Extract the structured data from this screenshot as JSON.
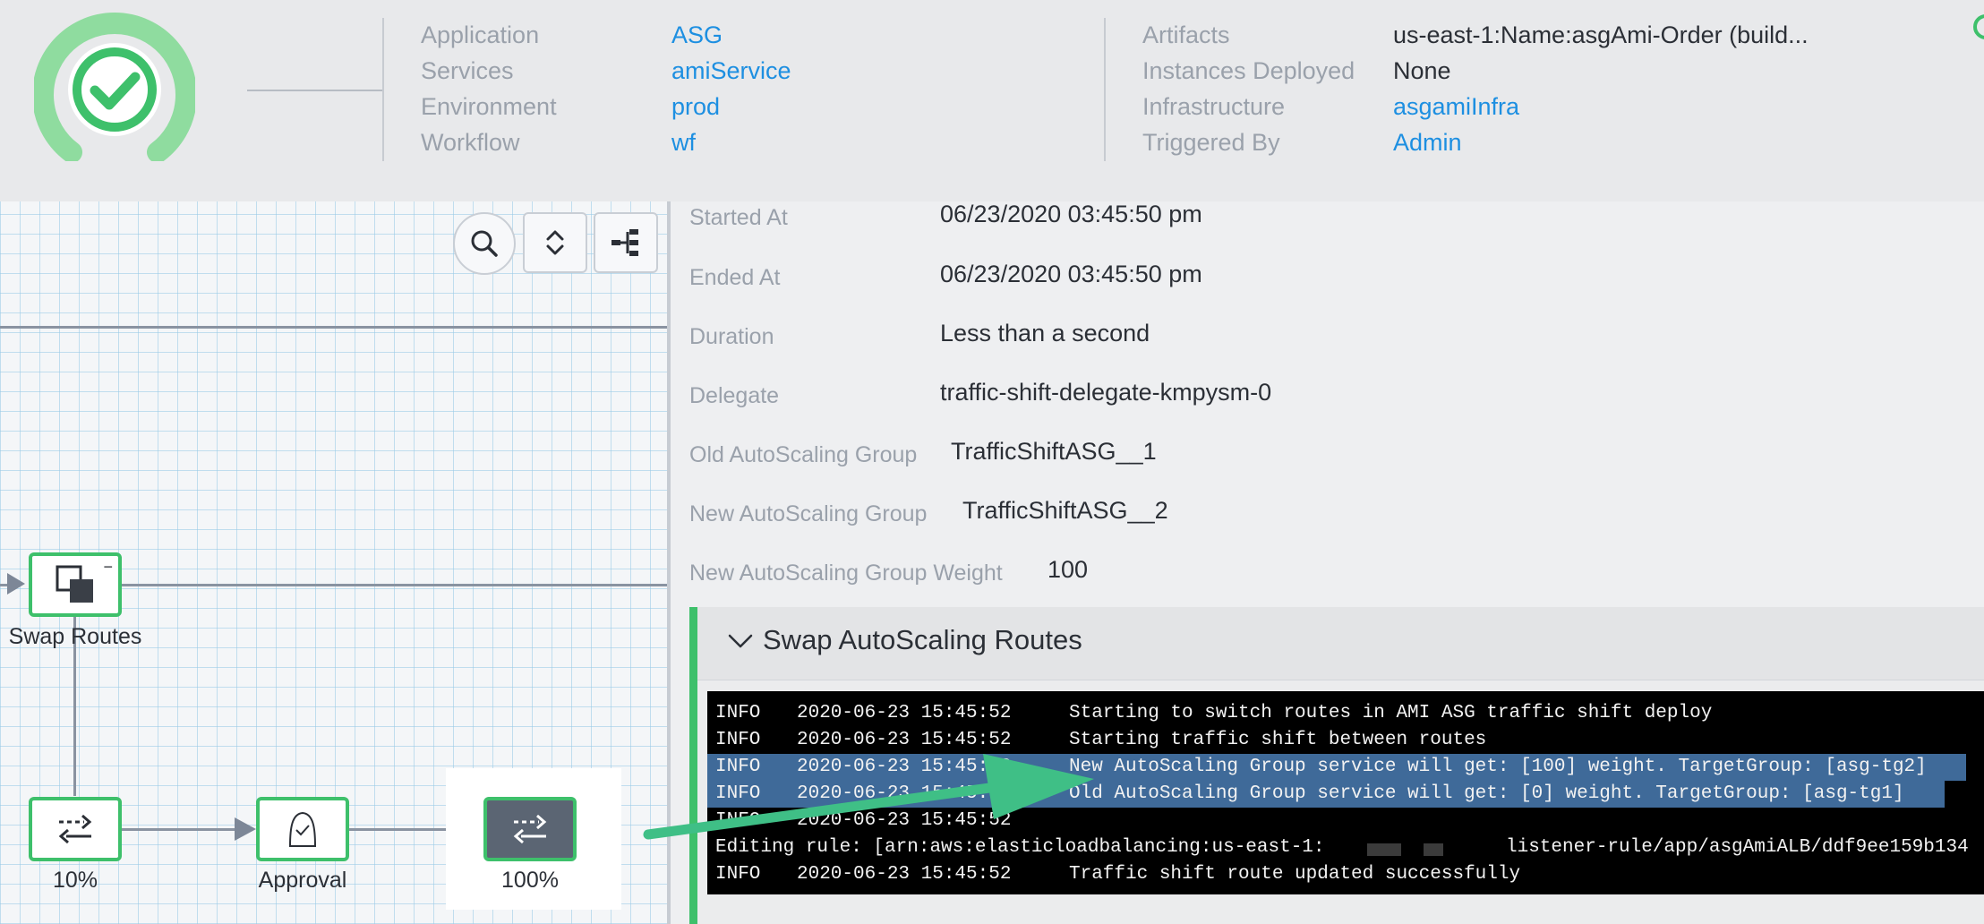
{
  "header": {
    "left_fields": [
      {
        "label": "Application",
        "value": "ASG"
      },
      {
        "label": "Services",
        "value": "amiService"
      },
      {
        "label": "Environment",
        "value": "prod"
      },
      {
        "label": "Workflow",
        "value": "wf"
      }
    ],
    "right_fields": [
      {
        "label": "Artifacts",
        "value": "us-east-1:Name:asgAmi-Order (build..."
      },
      {
        "label": "Instances Deployed",
        "value": "None"
      },
      {
        "label": "Infrastructure",
        "value": "asgamiInfra"
      },
      {
        "label": "Triggered By",
        "value": "Admin"
      }
    ]
  },
  "graph": {
    "nodes": {
      "swap_routes": "Swap Routes",
      "ten": "10%",
      "approval": "Approval",
      "hundred": "100%"
    }
  },
  "details": [
    {
      "label": "Started At",
      "value": "06/23/2020 03:45:50 pm"
    },
    {
      "label": "Ended At",
      "value": "06/23/2020 03:45:50 pm"
    },
    {
      "label": "Duration",
      "value": "Less than a second"
    },
    {
      "label": "Delegate",
      "value": "traffic-shift-delegate-kmpysm-0"
    },
    {
      "label": "Old AutoScaling Group",
      "value": "TrafficShiftASG__1"
    },
    {
      "label": "New AutoScaling Group",
      "value": "TrafficShiftASG__2"
    },
    {
      "label": "New AutoScaling Group Weight",
      "value": "100"
    }
  ],
  "section": {
    "title": "Swap AutoScaling Routes"
  },
  "logs": [
    {
      "level": "INFO",
      "time": "2020-06-23 15:45:52",
      "msg": "Starting to switch routes in AMI ASG traffic shift deploy"
    },
    {
      "level": "INFO",
      "time": "2020-06-23 15:45:52",
      "msg": "Starting traffic shift between routes"
    },
    {
      "level": "INFO",
      "time": "2020-06-23 15:45:52",
      "msg": "New AutoScaling Group service will get: [100] weight. TargetGroup: [asg-tg2]"
    },
    {
      "level": "INFO",
      "time": "2020-06-23 15:45:52",
      "msg": "Old AutoScaling Group service will get: [0] weight. TargetGroup: [asg-tg1]"
    },
    {
      "prefix": "Editing rule: [arn:aws:elasticloadbalancing:us-east-1:",
      "suffix": "listener-rule/app/asgAmiALB/ddf9ee159b134"
    },
    {
      "level": "INFO",
      "time": "2020-06-23 15:45:52",
      "msg": "Traffic shift route updated successfully"
    }
  ],
  "colors": {
    "success_green": "#3ec06b",
    "link_blue": "#1d8fe1",
    "annotation_arrow": "#3fbf86",
    "selection": "#3f6a99"
  }
}
